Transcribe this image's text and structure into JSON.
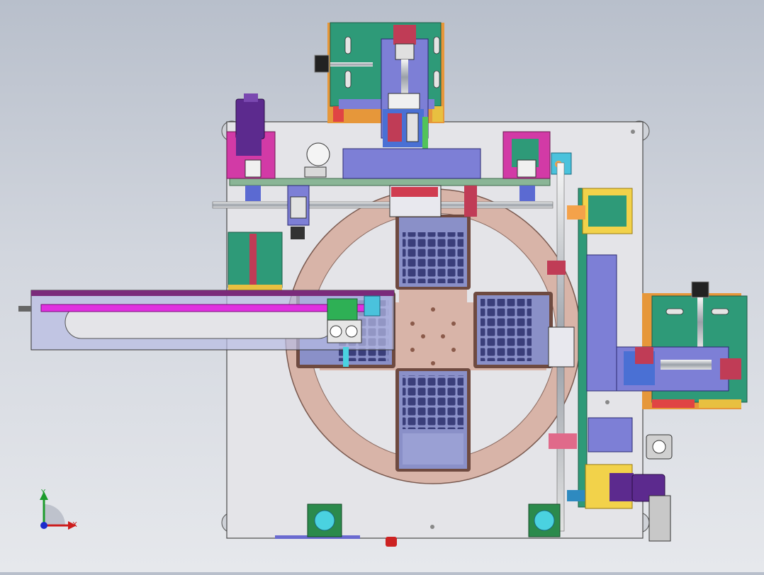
{
  "viewport": {
    "background_top": "#b8bfcb",
    "background_bottom": "#e6e8ec"
  },
  "triad": {
    "x_label": "X",
    "y_label": "Y",
    "x_color": "#cc1c1c",
    "y_color": "#1c9c2c",
    "z_color": "#1c2ccc"
  },
  "colors": {
    "base_plate": "#e4e4e8",
    "turntable": "#d8b4a8",
    "turntable_rim": "#a88276",
    "tray": "#8a90c8",
    "tray_cell": "#3a3e7a",
    "teal_plate": "#2e9a78",
    "magenta_bracket": "#d23aa6",
    "purple_block": "#7b72d6",
    "cylinder_purple": "#5c2a8e",
    "yellow_mount": "#f2d24a",
    "green_button": "#2b8a4c",
    "cyan_button": "#4ad2e0",
    "red_stop": "#cc2222"
  },
  "assemblies": [
    "base-plate",
    "rotary-turntable",
    "chip-trays",
    "top-feeder-module",
    "right-feeder-module",
    "left-linear-slide",
    "cross-rail",
    "vertical-rail",
    "control-buttons"
  ]
}
